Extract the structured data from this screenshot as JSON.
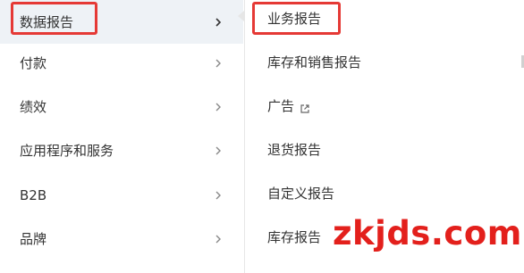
{
  "left_menu": {
    "items": [
      {
        "label": "数据报告"
      },
      {
        "label": "付款"
      },
      {
        "label": "绩效"
      },
      {
        "label": "应用程序和服务"
      },
      {
        "label": "B2B"
      },
      {
        "label": "品牌"
      }
    ]
  },
  "right_menu": {
    "items": [
      {
        "label": "业务报告"
      },
      {
        "label": "库存和销售报告"
      },
      {
        "label": "广告"
      },
      {
        "label": "退货报告"
      },
      {
        "label": "自定义报告"
      },
      {
        "label": "库存报告"
      }
    ]
  },
  "watermark": {
    "text": "zkjds.com"
  },
  "colors": {
    "highlight": "#e53935",
    "watermark": "#e3201c",
    "selected_bg": "#eef2f6"
  }
}
